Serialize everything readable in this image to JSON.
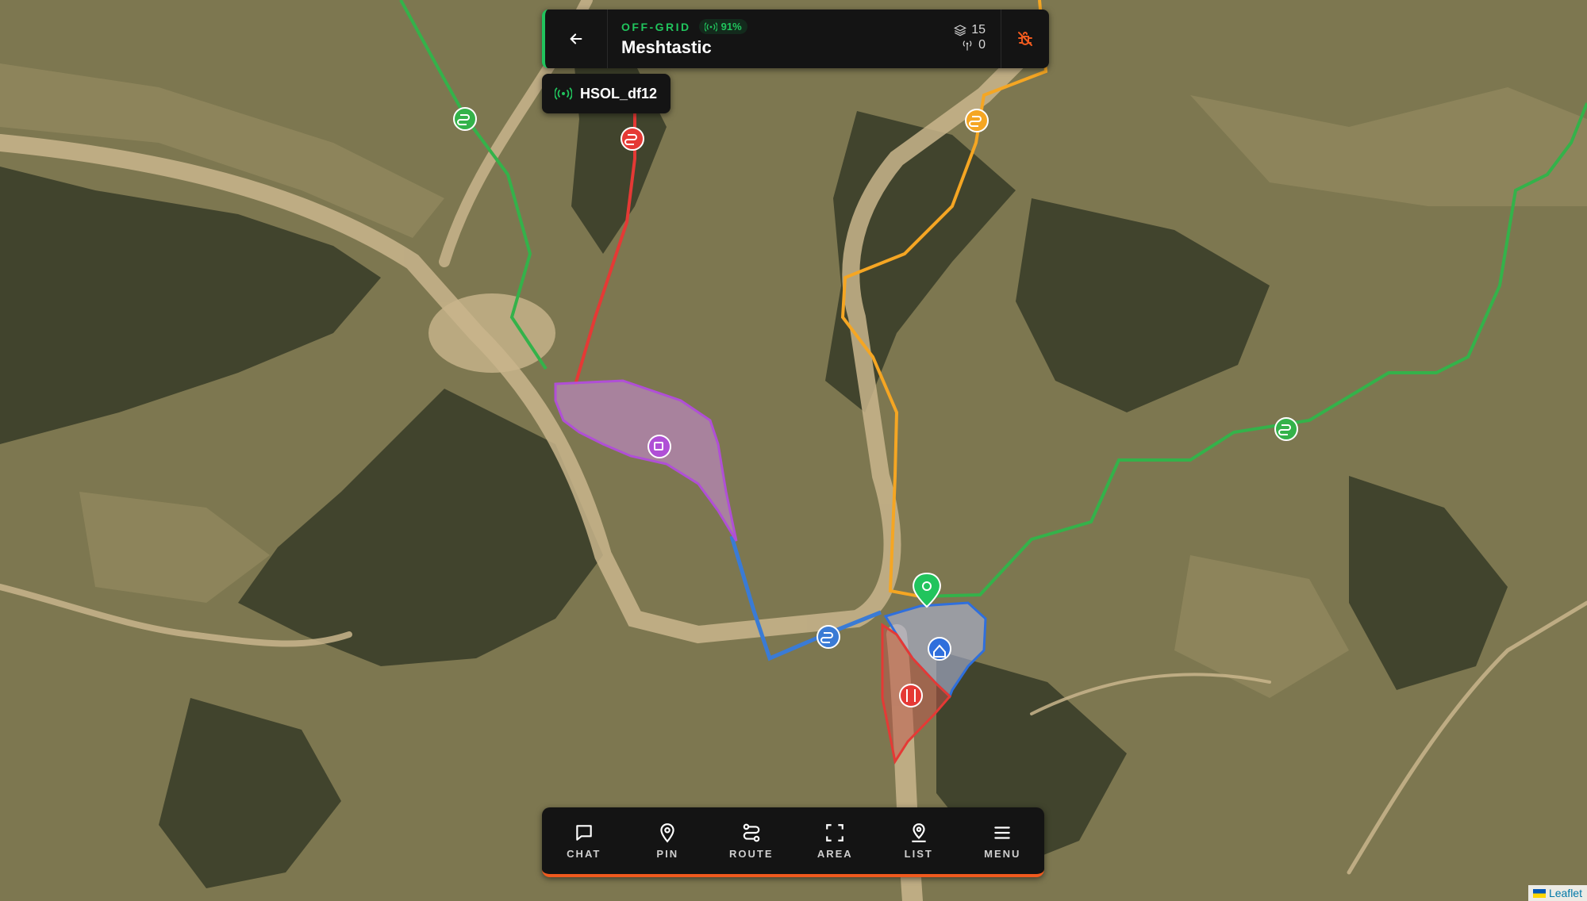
{
  "header": {
    "back_label": "Back",
    "mode": "OFF-GRID",
    "signal": "91%",
    "title": "Meshtastic",
    "layers_count": "15",
    "nodes_count": "0"
  },
  "node_badge": {
    "name": "HSOL_df12"
  },
  "toolbar": {
    "items": [
      {
        "label": "CHAT",
        "icon": "chat-icon"
      },
      {
        "label": "PIN",
        "icon": "pin-icon"
      },
      {
        "label": "ROUTE",
        "icon": "route-icon"
      },
      {
        "label": "AREA",
        "icon": "area-icon"
      },
      {
        "label": "LIST",
        "icon": "list-user-icon"
      },
      {
        "label": "MENU",
        "icon": "menu-icon"
      }
    ]
  },
  "attribution": {
    "text": "Leaflet"
  },
  "colors": {
    "accent_green": "#21c45d",
    "accent_orange": "#f05a1e",
    "route_red": "#e53935",
    "route_orange": "#f5a623",
    "route_blue": "#3a7bd5",
    "area_purple": "#b04fd6",
    "area_blue": "#2f6fdc",
    "area_red": "#e53935"
  }
}
